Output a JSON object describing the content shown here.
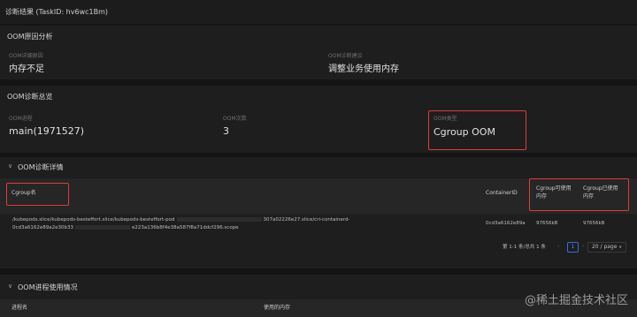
{
  "header": {
    "title": "诊断结果 (TaskID: hv6wc1Bm)"
  },
  "oom_cause": {
    "section_title": "OOM原因分析",
    "cause_label": "OOM详细原因",
    "cause_value": "内存不足",
    "advice_label": "OOM诊断建议",
    "advice_value": "调整业务使用内存"
  },
  "oom_overview": {
    "section_title": "OOM诊断总览",
    "process_label": "OOM进程",
    "process_value": "main(1971527)",
    "count_label": "OOM次数",
    "count_value": "3",
    "type_label": "OOM类型",
    "type_value": "Cgroup OOM"
  },
  "oom_detail": {
    "section_title": "OOM诊断详情",
    "columns": {
      "cgroup_name": "Cgroup名",
      "container_id": "ContainerID",
      "cgroup_available_line1": "Cgroup可使用",
      "cgroup_available_line2": "内存",
      "cgroup_used_line1": "Cgroup已使用",
      "cgroup_used_line2": "内存"
    },
    "row": {
      "cgroup_line1_a": "/kubepods.slice/kubepods-besteffort.slice/kubepods-besteffort-pod",
      "cgroup_line1_b": "307a02226e27.slice/cri-containerd-",
      "cgroup_line2_a": "0cd3a6162e89a2e30b33",
      "cgroup_line2_b": "e223a136b8f4e38a587f8a71ddcf296.scope",
      "container_id": "0cd3a6162e89a",
      "available": "97656kB",
      "used": "97656kB"
    },
    "pagination": {
      "summary": "第 1-1 条/总共 1 条",
      "prev": "‹",
      "page": "1",
      "next": "›",
      "page_size": "20 / page"
    }
  },
  "oom_process": {
    "section_title": "OOM进程使用情况",
    "col_process": "进程名",
    "col_memory": "使用的内存"
  },
  "watermark": "@稀土掘金技术社区",
  "colors": {
    "highlight": "#e03b3b",
    "accent": "#4a88ff",
    "background": "#141414"
  }
}
